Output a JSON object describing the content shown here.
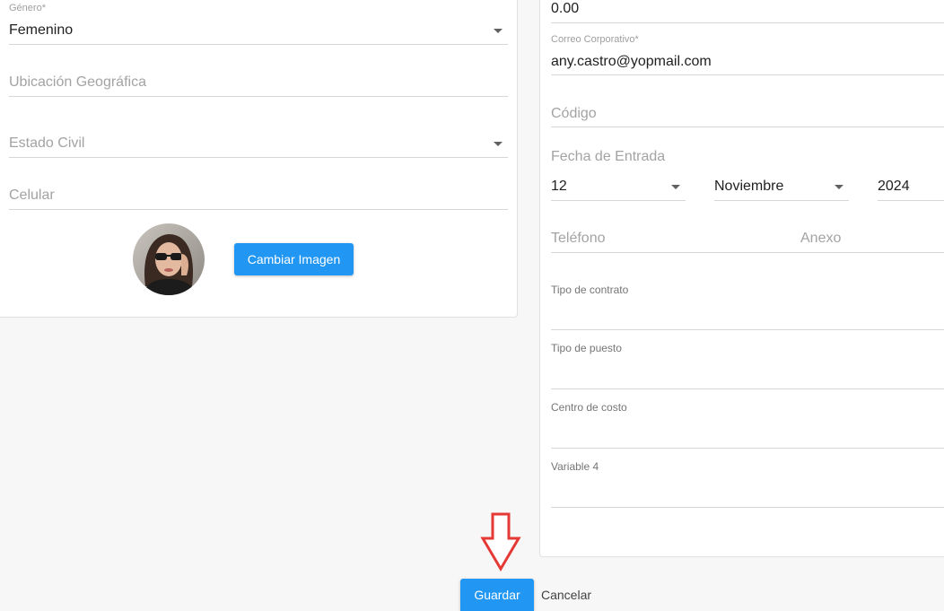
{
  "left": {
    "genero": {
      "label": "Género*",
      "value": "Femenino"
    },
    "ubicacion": {
      "placeholder": "Ubicación Geográfica"
    },
    "estado_civil": {
      "placeholder": "Estado Civil"
    },
    "celular": {
      "placeholder": "Celular"
    },
    "change_image_label": "Cambiar Imagen"
  },
  "right": {
    "top_value": "0.00",
    "correo": {
      "label": "Correo Corporativo*",
      "value": "any.castro@yopmail.com"
    },
    "codigo": {
      "placeholder": "Código"
    },
    "fecha": {
      "label": "Fecha de Entrada",
      "day": "12",
      "month": "Noviembre",
      "year": "2024"
    },
    "telefono": {
      "placeholder": "Teléfono"
    },
    "anexo": {
      "placeholder": "Anexo"
    },
    "tipo_contrato": {
      "label": "Tipo de contrato"
    },
    "tipo_puesto": {
      "label": "Tipo de puesto"
    },
    "centro_costo": {
      "label": "Centro de costo"
    },
    "variable4": {
      "label": "Variable 4"
    }
  },
  "footer": {
    "save_label": "Guardar",
    "cancel_label": "Cancelar"
  },
  "colors": {
    "primary": "#2196f3",
    "arrow": "#e53935"
  },
  "icons": [
    "chevron-down-icon",
    "down-arrow-annotation-icon"
  ]
}
